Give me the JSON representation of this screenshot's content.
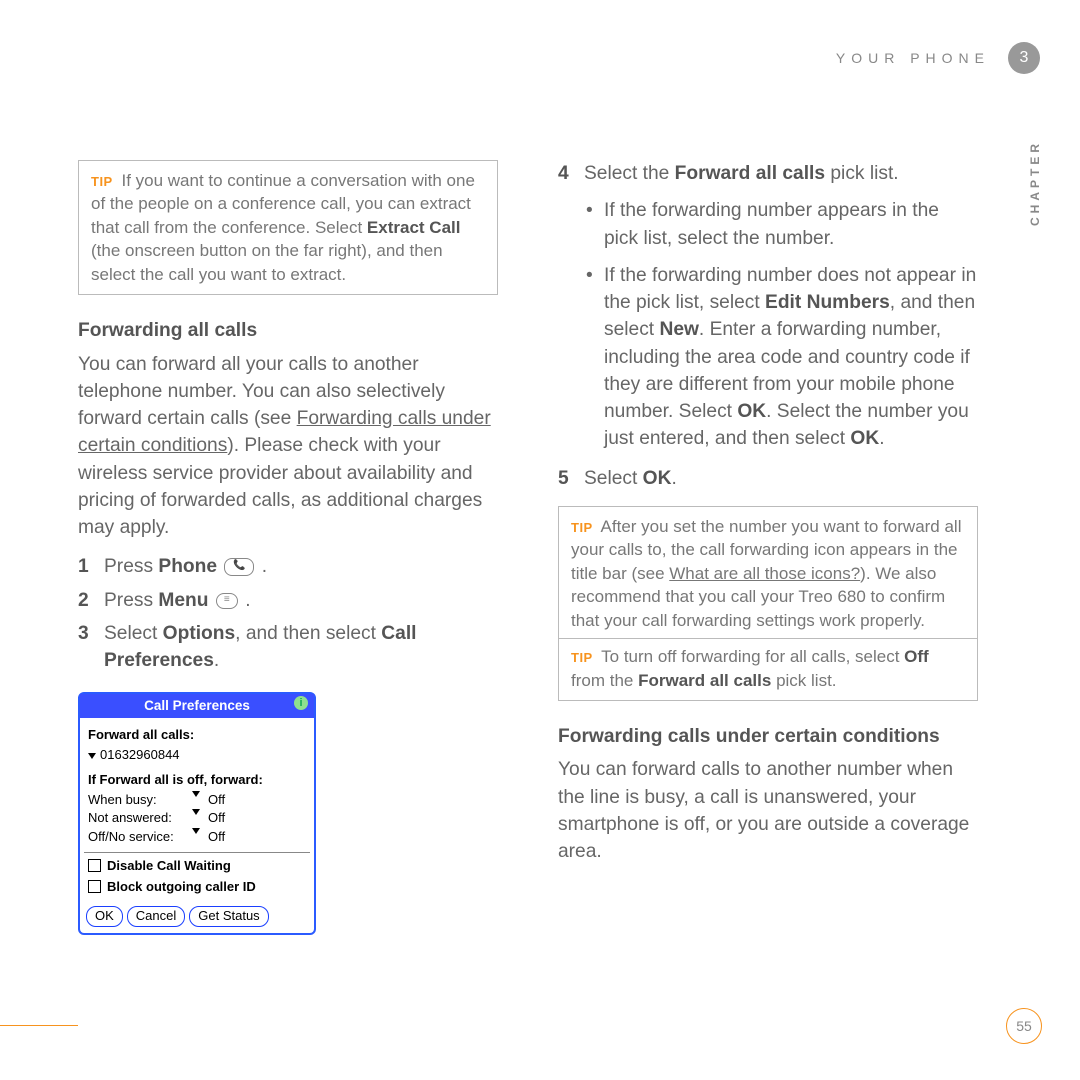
{
  "strings": {
    "tip": "TIP"
  },
  "header": {
    "section": "YOUR PHONE",
    "chapter_num": "3",
    "chapter_word": "CHAPTER"
  },
  "footer": {
    "page": "55"
  },
  "left": {
    "tip1": {
      "a": "If you want to continue a conversation with one of the people on a conference call, you can extract that call from the conference. Select ",
      "extract": "Extract Call",
      "b": " (the onscreen button on the far right), and then select the call you want to extract."
    },
    "h2": "Forwarding all calls",
    "para": {
      "a": "You can forward all your calls to another telephone number. You can also selectively forward certain calls (see ",
      "link": "Forwarding calls under certain conditions",
      "b": "). Please check with your wireless service provider about availability and pricing of forwarded calls, as additional charges may apply."
    },
    "steps": [
      {
        "num": "1",
        "a": "Press ",
        "bold": "Phone"
      },
      {
        "num": "2",
        "a": "Press ",
        "bold": "Menu"
      },
      {
        "num": "3",
        "a": "Select ",
        "bold1": "Options",
        "b": ", and then select ",
        "bold2": "Call Preferences"
      }
    ]
  },
  "fig": {
    "title": "Call Preferences",
    "forward_label": "Forward all calls:",
    "forward_value": "01632960844",
    "ifoff_label": "If Forward all is off, forward:",
    "rows": [
      {
        "lab": "When busy:",
        "val": "Off"
      },
      {
        "lab": "Not answered:",
        "val": "Off"
      },
      {
        "lab": "Off/No service:",
        "val": "Off"
      }
    ],
    "cb1": "Disable Call Waiting",
    "cb2": "Block outgoing caller ID",
    "btns": [
      "OK",
      "Cancel",
      "Get Status"
    ]
  },
  "right": {
    "step4": {
      "num": "4",
      "a": "Select the ",
      "bold": "Forward all calls",
      "b": " pick list."
    },
    "bullets": {
      "0": "If the forwarding number appears in the pick list, select the number.",
      "1": {
        "a": "If the forwarding number does not appear in the pick list, select ",
        "edit": "Edit Numbers",
        "b": ", and then select ",
        "new": "New",
        "c": ". Enter a forwarding number, including the area code and country code if they are different from your mobile phone number. Select ",
        "ok1": "OK",
        "d": ". Select the number you just entered, and then select ",
        "ok2": "OK"
      }
    },
    "step5": {
      "num": "5",
      "a": "Select ",
      "bold": "OK"
    },
    "tip2": {
      "a": "After you set the number you want to forward all your calls to, the call forwarding icon appears in the title bar (see ",
      "link": "What are all those icons?",
      "b": "). We also recommend that you call your Treo 680 to confirm that your call forwarding settings work properly."
    },
    "tip3": {
      "a": "To turn off forwarding for all calls, select ",
      "off": "Off",
      "b": " from the ",
      "pick": "Forward all calls",
      "c": " pick list."
    },
    "h2": "Forwarding calls under certain conditions",
    "para": "You can forward calls to another number when the line is busy, a call is unanswered, your smartphone is off, or you are outside a coverage area."
  }
}
